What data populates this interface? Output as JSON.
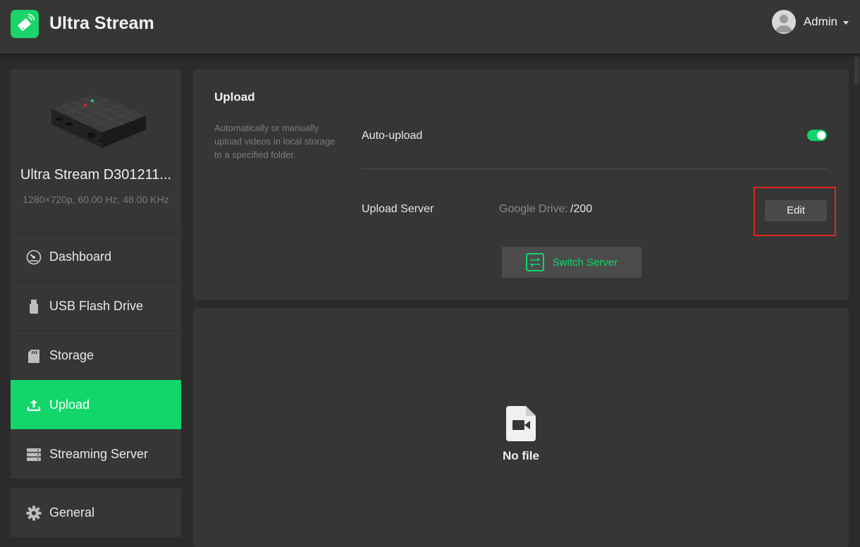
{
  "app": {
    "title": "Ultra Stream",
    "accent_color": "#12d66a",
    "logo_icon": "stream-device-icon"
  },
  "user": {
    "name": "Admin",
    "avatar_icon": "user-avatar-icon"
  },
  "device": {
    "name": "Ultra Stream D301211...",
    "spec": "1280×720p, 60.00 Hz, 48.00 KHz"
  },
  "sidebar": {
    "items": [
      {
        "label": "Dashboard",
        "icon": "gauge-icon"
      },
      {
        "label": "USB Flash Drive",
        "icon": "usb-drive-icon"
      },
      {
        "label": "Storage",
        "icon": "sd-card-icon"
      },
      {
        "label": "Upload",
        "icon": "upload-icon",
        "active": true
      },
      {
        "label": "Streaming Server",
        "icon": "server-icon"
      }
    ],
    "secondary_items": [
      {
        "label": "General",
        "icon": "gear-icon"
      }
    ]
  },
  "upload": {
    "title": "Upload",
    "description": "Automatically or manually upload videos in local storage to a specified folder.",
    "auto_upload_label": "Auto-upload",
    "auto_upload_enabled": true,
    "server_label": "Upload Server",
    "server_provider": "Google Drive:",
    "server_path": "/200",
    "edit_label": "Edit",
    "switch_label": "Switch Server"
  },
  "files": {
    "empty_label": "No file",
    "empty_icon": "video-file-icon"
  },
  "colors": {
    "highlight": "#e0261f",
    "panel": "#363636",
    "background": "#2b2b2b"
  }
}
